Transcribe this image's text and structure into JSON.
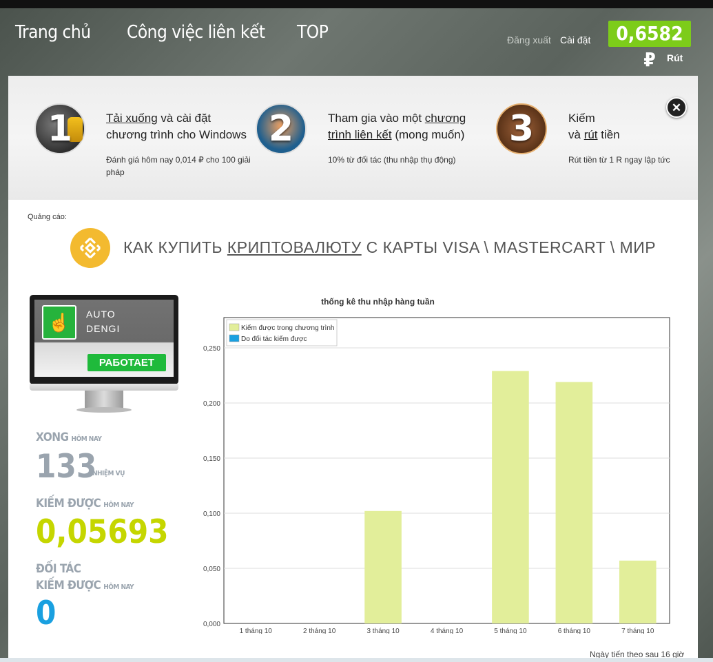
{
  "nav": {
    "home": "Trang chủ",
    "links": "Công việc liên kết",
    "top": "TOP"
  },
  "account": {
    "logout": "Đăng xuất",
    "settings": "Cài đặt",
    "balance": "0,6582 ₽",
    "withdraw": "Rút"
  },
  "steps": [
    {
      "number": "1",
      "title_link": "Tải xuống",
      "title_rest": " và cài đặt chương trình cho Windows",
      "desc": "Đánh giá hôm nay 0,014 ₽ cho 100 giải pháp"
    },
    {
      "number": "2",
      "title_pre": "Tham gia vào một ",
      "title_link": "chương trình liên kết",
      "title_rest": " (mong muốn)",
      "desc": "10% từ đối tác (thu nhập thụ động)"
    },
    {
      "number": "3",
      "title_pre": "Kiếm",
      "title_mid": "và ",
      "title_link": "rút",
      "title_rest": " tiền",
      "desc": "Rút tiền từ 1 R ngay lập tức"
    }
  ],
  "close_symbol": "✕",
  "ad": {
    "label": "Quảng cáo:",
    "text_pre": "КАК КУПИТЬ ",
    "text_link": "КРИПТОВАЛЮТУ",
    "text_rest": " С КАРТЫ VISA \\ MASTERCART \\ МИР"
  },
  "app": {
    "name_line1": "AUTO",
    "name_line2": "DENGI",
    "status": "РАБОТАЕТ",
    "icon": "hand-tap-icon"
  },
  "stats": {
    "done_label": "XONG",
    "done_suffix": "HÔM NAY",
    "done_value": "133",
    "done_unit": "NHIỆM VỤ",
    "earned_label": "KIẾM ĐƯỢC",
    "earned_suffix": "HÔM NAY",
    "earned_value": "0,05693",
    "partner_label1": "ĐỐI TÁC",
    "partner_label2": "KIẾM ĐƯỢC",
    "partner_suffix": "HÔM NAY",
    "partner_value": "0"
  },
  "colors": {
    "earned": "#c5d600",
    "partner": "#1aa0e0",
    "muted": "#9aa4ae",
    "bar": "#e2ee9a",
    "bar2": "#1aa0e0",
    "accent": "#7dcc1a"
  },
  "chart_data": {
    "type": "bar",
    "title": "thống kê thu nhập hàng tuần",
    "categories": [
      "1 tháng 10",
      "2 tháng 10",
      "3 tháng 10",
      "4 tháng 10",
      "5 tháng 10",
      "6 tháng 10",
      "7 tháng 10"
    ],
    "series": [
      {
        "name": "Kiếm được trong chương trình",
        "values": [
          0,
          0,
          0.102,
          0,
          0.229,
          0.219,
          0.057
        ]
      },
      {
        "name": "Do đối tác kiếm được",
        "values": [
          0,
          0,
          0,
          0,
          0,
          0,
          0
        ]
      }
    ],
    "ylim": [
      0,
      0.25
    ],
    "yticks": [
      "0,000",
      "0,050",
      "0,100",
      "0,150",
      "0,200",
      "0,250"
    ],
    "grid": true,
    "legend": "top-left"
  },
  "footnote": "Ngày tiến theo sau 16 giờ"
}
